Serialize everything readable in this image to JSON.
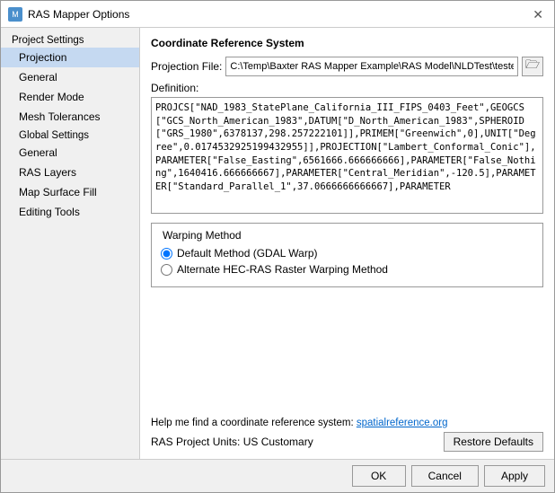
{
  "window": {
    "title": "RAS Mapper Options",
    "icon": "M"
  },
  "sidebar": {
    "project_settings_label": "Project Settings",
    "items": [
      {
        "id": "projection",
        "label": "Projection",
        "active": true,
        "indent": "item"
      },
      {
        "id": "general-top",
        "label": "General",
        "active": false,
        "indent": "item"
      },
      {
        "id": "render-mode",
        "label": "Render Mode",
        "active": false,
        "indent": "item"
      },
      {
        "id": "mesh-tolerances",
        "label": "Mesh Tolerances",
        "active": false,
        "indent": "item"
      }
    ],
    "global_settings_label": "Global Settings",
    "items2": [
      {
        "id": "general-bottom",
        "label": "General",
        "active": false
      },
      {
        "id": "ras-layers",
        "label": "RAS Layers",
        "active": false
      },
      {
        "id": "map-surface-fill",
        "label": "Map Surface Fill",
        "active": false
      },
      {
        "id": "editing-tools",
        "label": "Editing Tools",
        "active": false
      }
    ]
  },
  "content": {
    "section_title": "Coordinate Reference System",
    "projection_label": "Projection File:",
    "projection_value": "C:\\Temp\\Baxter RAS Mapper Example\\RAS Model\\NLDTest\\testes",
    "definition_label": "Definition:",
    "definition_text": "PROJCS[\"NAD_1983_StatePlane_California_III_FIPS_0403_Feet\",GEOGCS[\"GCS_North_American_1983\",DATUM[\"D_North_American_1983\",SPHEROID[\"GRS_1980\",6378137,298.257222101]],PRIMEM[\"Greenwich\",0],UNIT[\"Degree\",0.0174532925199432955]],PROJECTION[\"Lambert_Conformal_Conic\"],PARAMETER[\"False_Easting\",6561666.666666666],PARAMETER[\"False_Nothing\",1640416.666666667],PARAMETER[\"Central_Meridian\",-120.5],PARAMETER[\"Standard_Parallel_1\",37.0666666666667],PARAMETER",
    "warping": {
      "legend": "Warping Method",
      "options": [
        {
          "id": "default",
          "label": "Default Method (GDAL Warp)",
          "selected": true
        },
        {
          "id": "alternate",
          "label": "Alternate HEC-RAS Raster Warping Method",
          "selected": false
        }
      ]
    },
    "help_text": "Help me find a coordinate reference system:",
    "help_link_text": "spatialreference.org",
    "units_label": "RAS Project Units: US Customary",
    "restore_btn": "Restore Defaults"
  },
  "bottom_bar": {
    "ok": "OK",
    "cancel": "Cancel",
    "apply": "Apply"
  }
}
